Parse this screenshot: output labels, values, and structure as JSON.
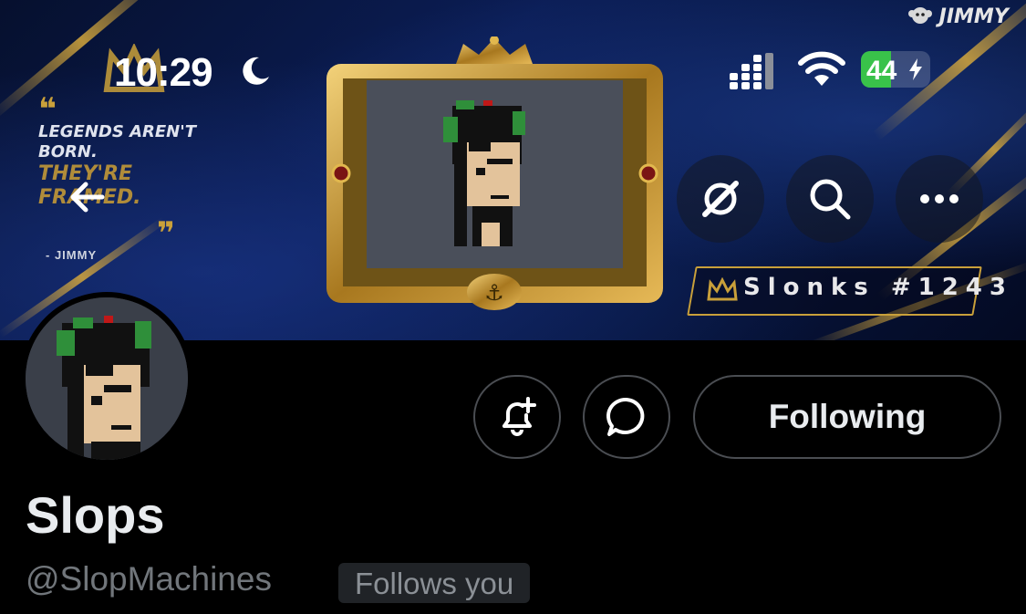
{
  "status_bar": {
    "time": "10:29",
    "battery_level": "44",
    "battery_fraction": 0.44,
    "icons": [
      "moon-icon",
      "cellular-signal-icon",
      "wifi-icon",
      "battery-charging-icon"
    ]
  },
  "banner": {
    "watermark": "JIMMY",
    "quote": {
      "open_mark": "❝",
      "line1": "LEGENDS AREN'T",
      "line2": "BORN.",
      "line3": "THEY'RE",
      "line4": "FRAMED.",
      "close_mark": "❞",
      "author": "- JIMMY"
    },
    "nft_label": "Slonks #1243",
    "colors": {
      "gold": "#c9a03a",
      "navy": "#0b1d55"
    }
  },
  "header_actions": {
    "back": "arrow-left-icon",
    "grok": "grok-icon",
    "search": "search-icon",
    "more": "more-horizontal-icon"
  },
  "profile": {
    "display_name": "Slops",
    "handle": "@SlopMachines",
    "follows_you": "Follows you",
    "following_button": "Following"
  }
}
